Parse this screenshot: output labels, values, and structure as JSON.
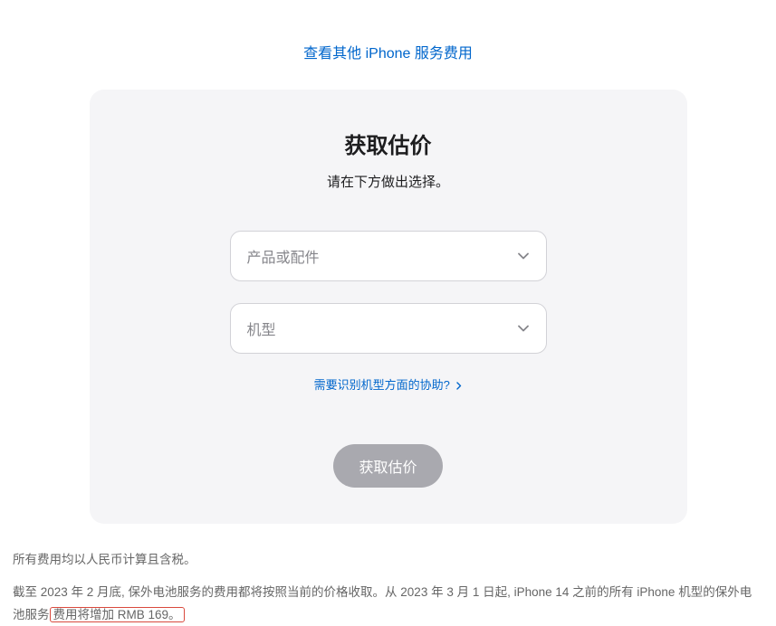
{
  "topLink": {
    "label": "查看其他 iPhone 服务费用"
  },
  "card": {
    "title": "获取估价",
    "subtitle": "请在下方做出选择。",
    "selectProduct": {
      "placeholder": "产品或配件"
    },
    "selectModel": {
      "placeholder": "机型"
    },
    "helpLink": {
      "label": "需要识别机型方面的协助?"
    },
    "submit": {
      "label": "获取估价"
    }
  },
  "footnote": {
    "line1": "所有费用均以人民币计算且含税。",
    "line2_part1": "截至 2023 年 2 月底, 保外电池服务的费用都将按照当前的价格收取。从 2023 年 3 月 1 日起, iPhone 14 之前的所有 iPhone 机型的保外电池服务",
    "line2_highlight": "费用将增加 RMB 169。"
  }
}
